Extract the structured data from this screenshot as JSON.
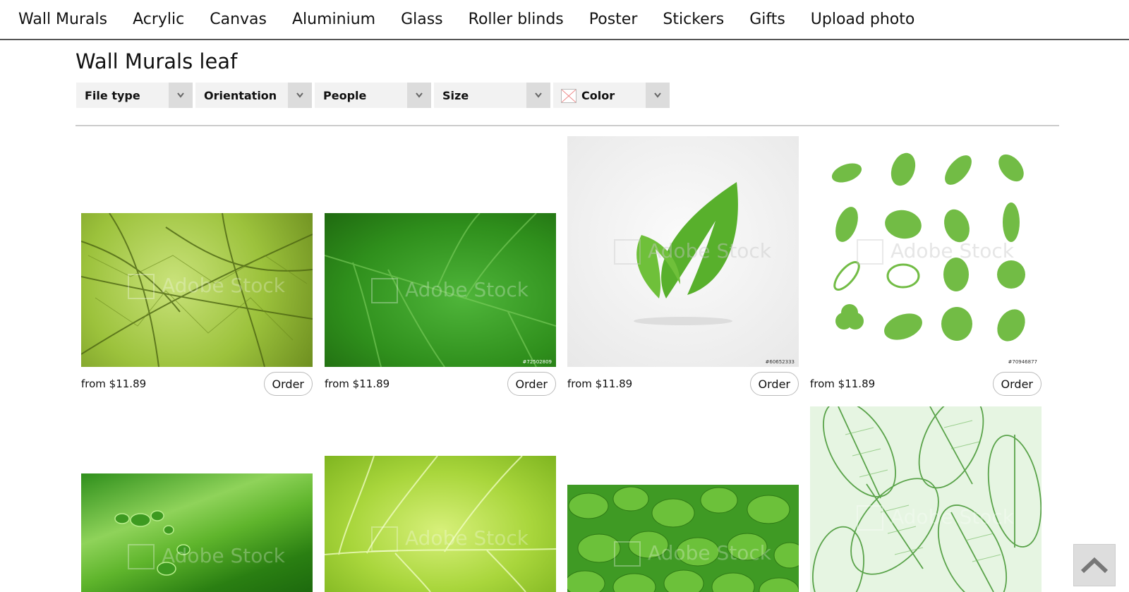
{
  "nav": {
    "items": [
      "Wall Murals",
      "Acrylic",
      "Canvas",
      "Aluminium",
      "Glass",
      "Roller blinds",
      "Poster",
      "Stickers",
      "Gifts",
      "Upload photo"
    ]
  },
  "page": {
    "title": "Wall Murals leaf"
  },
  "filters": [
    {
      "label": "File type"
    },
    {
      "label": "Orientation"
    },
    {
      "label": "People"
    },
    {
      "label": "Size"
    },
    {
      "label": "Color"
    }
  ],
  "watermark": "Adobe Stock",
  "products": [
    {
      "price": "from $11.89",
      "order": "Order",
      "stock_id": ""
    },
    {
      "price": "from $11.89",
      "order": "Order",
      "stock_id": "#72502809"
    },
    {
      "price": "from $11.89",
      "order": "Order",
      "stock_id": "#60652333"
    },
    {
      "price": "from $11.89",
      "order": "Order",
      "stock_id": "#70946877"
    },
    {
      "price": "",
      "order": "",
      "stock_id": ""
    },
    {
      "price": "",
      "order": "",
      "stock_id": ""
    },
    {
      "price": "",
      "order": "",
      "stock_id": ""
    },
    {
      "price": "",
      "order": "",
      "stock_id": ""
    }
  ],
  "icons": {
    "filter_caret": "chevron-down-icon",
    "color_swatch": "no-color-swatch-icon",
    "back_to_top": "chevron-up-icon"
  },
  "colors": {
    "leaf_green": "#7cc13a",
    "filter_bg": "#f2f2f2",
    "caret_bg": "#dcdcdc"
  }
}
